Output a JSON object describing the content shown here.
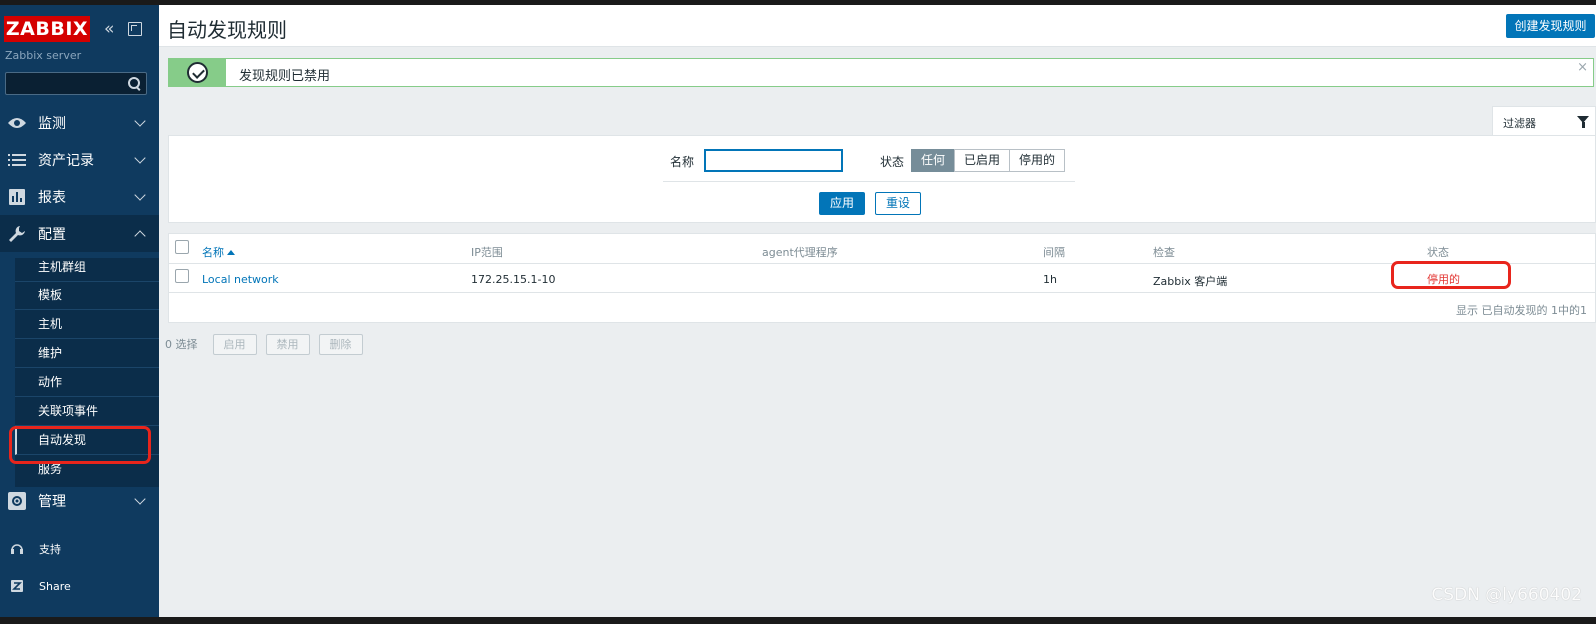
{
  "sidebar": {
    "logo": "ZABBIX",
    "server_name": "Zabbix server",
    "search_placeholder": "",
    "menu": [
      {
        "label": "监测",
        "icon": "eye-icon"
      },
      {
        "label": "资产记录",
        "icon": "list-icon"
      },
      {
        "label": "报表",
        "icon": "bar-chart-icon"
      },
      {
        "label": "配置",
        "icon": "wrench-icon"
      },
      {
        "label": "管理",
        "icon": "gear-icon"
      }
    ],
    "config_submenu": [
      "主机群组",
      "模板",
      "主机",
      "维护",
      "动作",
      "关联项事件",
      "自动发现",
      "服务"
    ],
    "bottom": [
      {
        "label": "支持",
        "icon": "headset-icon"
      },
      {
        "label": "Share",
        "icon": "share-z-icon"
      }
    ]
  },
  "header": {
    "title": "自动发现规则",
    "create_button": "创建发现规则"
  },
  "message": {
    "text": "发现规则已禁用",
    "close": "×"
  },
  "filter": {
    "tab_label": "过滤器",
    "name_label": "名称",
    "name_value": "",
    "status_label": "状态",
    "status_options": [
      "任何",
      "已启用",
      "停用的"
    ],
    "status_selected": "任何",
    "apply": "应用",
    "reset": "重设"
  },
  "table": {
    "columns": [
      "名称",
      "IP范围",
      "agent代理程序",
      "间隔",
      "检查",
      "状态"
    ],
    "rows": [
      {
        "name": "Local network",
        "ip_range": "172.25.15.1-10",
        "proxy": "",
        "interval": "1h",
        "checks": "Zabbix 客户端",
        "status": "停用的"
      }
    ],
    "footer": "显示 已自动发现的 1中的1"
  },
  "bulk_actions": {
    "selected": "0 选择",
    "buttons": [
      "启用",
      "禁用",
      "删除"
    ]
  },
  "watermark": "CSDN @ly660402",
  "colors": {
    "sidebar_bg": "#0f3a5f",
    "accent": "#0275b8",
    "logo_red": "#d40000",
    "success_green": "#86cc89",
    "disabled_red": "#e33734",
    "highlight_red": "#e8251c"
  }
}
